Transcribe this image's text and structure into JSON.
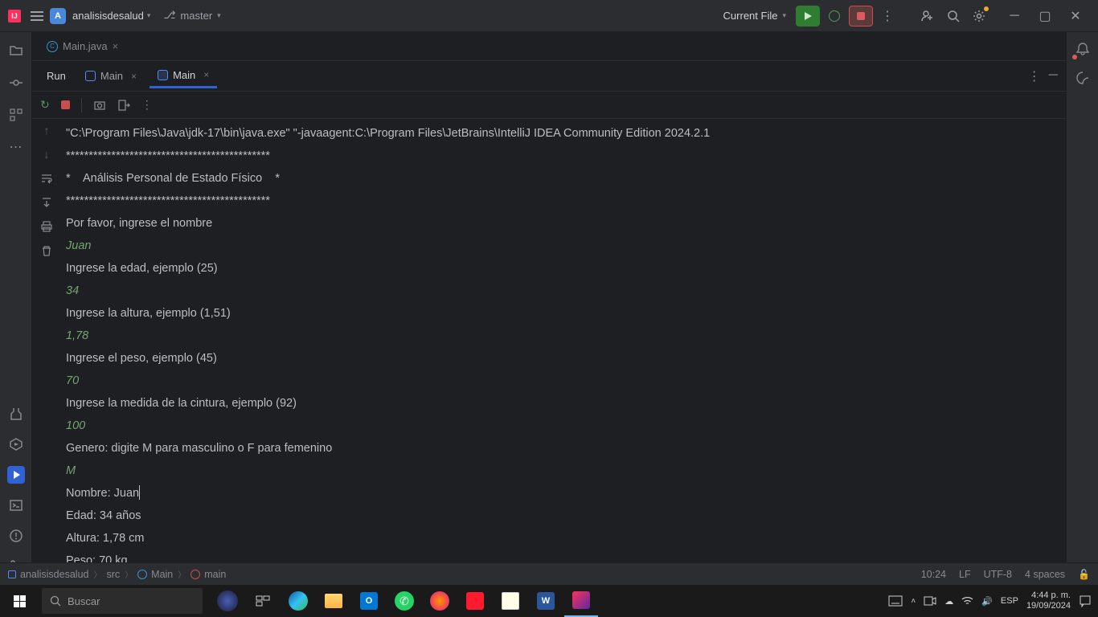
{
  "titlebar": {
    "project_initial": "A",
    "project_name": "analisisdesalud",
    "branch": "master",
    "run_target": "Current File"
  },
  "file_tab": {
    "name": "Main.java"
  },
  "run_panel": {
    "label": "Run",
    "tabs": [
      {
        "label": "Main",
        "active": false
      },
      {
        "label": "Main",
        "active": true
      }
    ]
  },
  "console": {
    "cmd": "\"C:\\Program Files\\Java\\jdk-17\\bin\\java.exe\" \"-javaagent:C:\\Program Files\\JetBrains\\IntelliJ IDEA Community Edition 2024.2.1",
    "border": "*********************************************",
    "title": "*    Análisis Personal de Estado Físico    *",
    "p_nombre": "Por favor, ingrese el nombre",
    "i_nombre": "Juan",
    "p_edad": "Ingrese la edad, ejemplo (25)",
    "i_edad": "34",
    "p_altura": "Ingrese la altura, ejemplo (1,51)",
    "i_altura": "1,78",
    "p_peso": "Ingrese el peso, ejemplo (45)",
    "i_peso": "70",
    "p_cintura": "Ingrese la medida de la cintura, ejemplo (92)",
    "i_cintura": "100",
    "p_genero": "Genero: digite M para masculino o F para femenino",
    "i_genero": "M",
    "o_nombre": "Nombre: Juan",
    "o_edad": "Edad: 34 años",
    "o_altura": "Altura: 1,78 cm",
    "o_peso": "Peso: 70 kg"
  },
  "breadcrumb": {
    "project": "analisisdesalud",
    "src": "src",
    "class": "Main",
    "method": "main"
  },
  "status": {
    "pos": "10:24",
    "eol": "LF",
    "enc": "UTF-8",
    "indent": "4 spaces"
  },
  "taskbar": {
    "search_placeholder": "Buscar",
    "lang": "ESP",
    "time": "4:44 p. m.",
    "date": "19/09/2024"
  }
}
